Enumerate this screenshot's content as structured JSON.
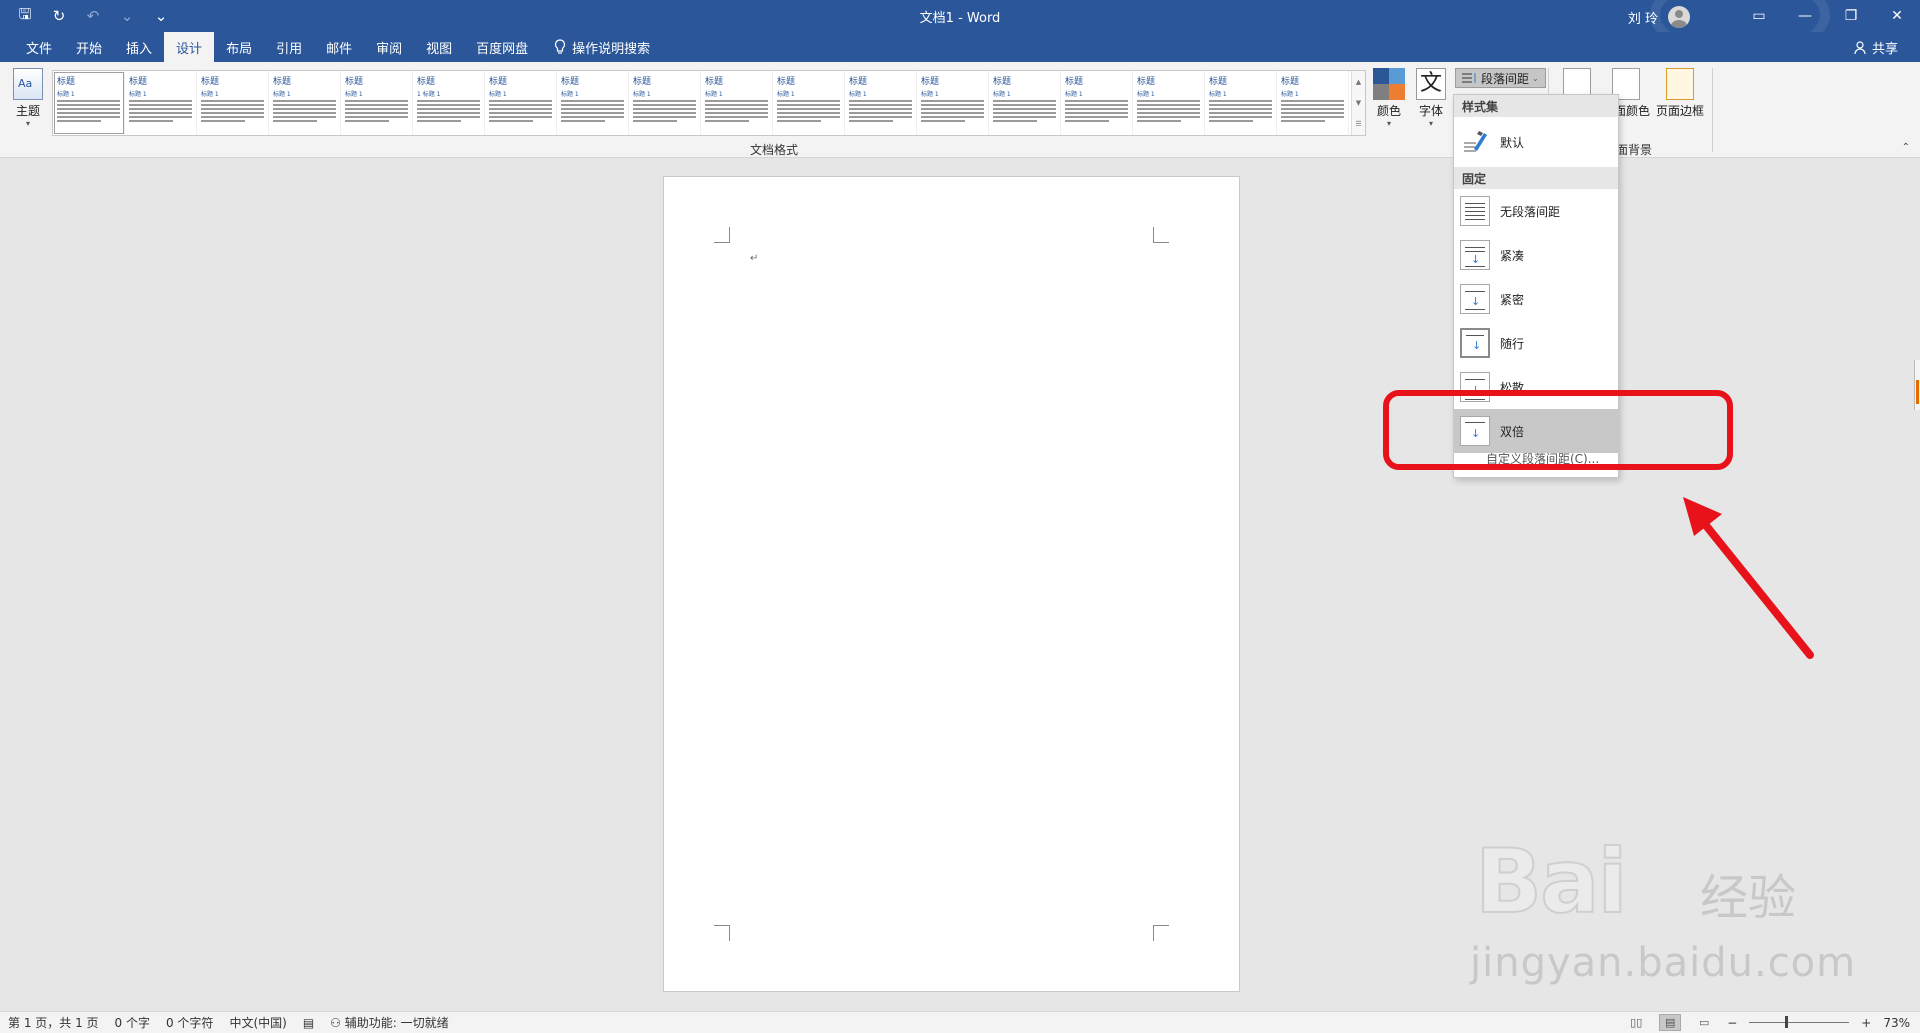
{
  "window": {
    "title": "文档1  -  Word",
    "user_name": "刘 玲",
    "qat": {
      "save": "🖫",
      "redo": "↻",
      "undo": "↶",
      "undo_more": "⌄",
      "customize": "⌄"
    },
    "controls": {
      "ribbon_options": "▭",
      "minimize": "—",
      "restore": "❐",
      "close": "✕"
    }
  },
  "tabs": [
    {
      "label": "文件"
    },
    {
      "label": "开始"
    },
    {
      "label": "插入"
    },
    {
      "label": "设计"
    },
    {
      "label": "布局"
    },
    {
      "label": "引用"
    },
    {
      "label": "邮件"
    },
    {
      "label": "审阅"
    },
    {
      "label": "视图"
    },
    {
      "label": "百度网盘"
    }
  ],
  "tell_me": "操作说明搜索",
  "share": "共享",
  "ribbon": {
    "theme_label": "主题",
    "gallery_group_label": "文档格式",
    "gallery_items": [
      {
        "title": "标题",
        "sub": "标题 1"
      },
      {
        "title": "标题",
        "sub": "标题 1"
      },
      {
        "title": "标题",
        "sub": "标题 1"
      },
      {
        "title": "标题",
        "sub": "标题 1"
      },
      {
        "title": "标题",
        "sub": "标题 1"
      },
      {
        "title": "标题",
        "sub": "1 标题 1"
      },
      {
        "title": "标题",
        "sub": "标题 1"
      },
      {
        "title": "标题",
        "sub": "标题 1"
      },
      {
        "title": "标题",
        "sub": "标题 1"
      },
      {
        "title": "标题",
        "sub": "标题 1"
      },
      {
        "title": "标题",
        "sub": "标题 1"
      },
      {
        "title": "标题",
        "sub": "标题 1"
      },
      {
        "title": "标题",
        "sub": "标题 1"
      },
      {
        "title": "标题",
        "sub": "标题 1"
      },
      {
        "title": "标题",
        "sub": "标题 1"
      },
      {
        "title": "标题",
        "sub": "标题 1"
      },
      {
        "title": "标题",
        "sub": "标题 1"
      },
      {
        "title": "标题",
        "sub": "标题 1"
      }
    ],
    "colors_label": "颜色",
    "fonts_label": "字体",
    "font_glyph": "文",
    "paragraph_spacing_label": "段落间距",
    "page_color_label": "页面颜色",
    "page_borders_label": "页面边框",
    "page_background_group_label": "页面背景",
    "palette_colors": [
      "#2b5797",
      "#5b9bd5",
      "#7f7f7f",
      "#ed7d31"
    ]
  },
  "dropdown": {
    "style_set_header": "样式集",
    "default_label": "默认",
    "fixed_header": "固定",
    "items": [
      {
        "label": "无段落间距"
      },
      {
        "label": "紧凑"
      },
      {
        "label": "紧密"
      },
      {
        "label": "随行"
      },
      {
        "label": "松散"
      },
      {
        "label": "双倍"
      }
    ],
    "more_label": "自定义段落间距(C)..."
  },
  "document": {
    "pilcrow": "↵"
  },
  "watermark": {
    "logo": "Bai",
    "jingyan": "经验",
    "url": "jingyan.baidu.com"
  },
  "statusbar": {
    "page": "第 1 页，共 1 页",
    "words": "0 个字",
    "chars": "0 个字符",
    "language": "中文(中国)",
    "accessibility": "辅助功能: 一切就绪",
    "zoom": "73%",
    "zoom_out": "−",
    "zoom_in": "+"
  },
  "colors": {
    "word_blue": "#2b579a",
    "highlight_red": "#e8121a"
  }
}
